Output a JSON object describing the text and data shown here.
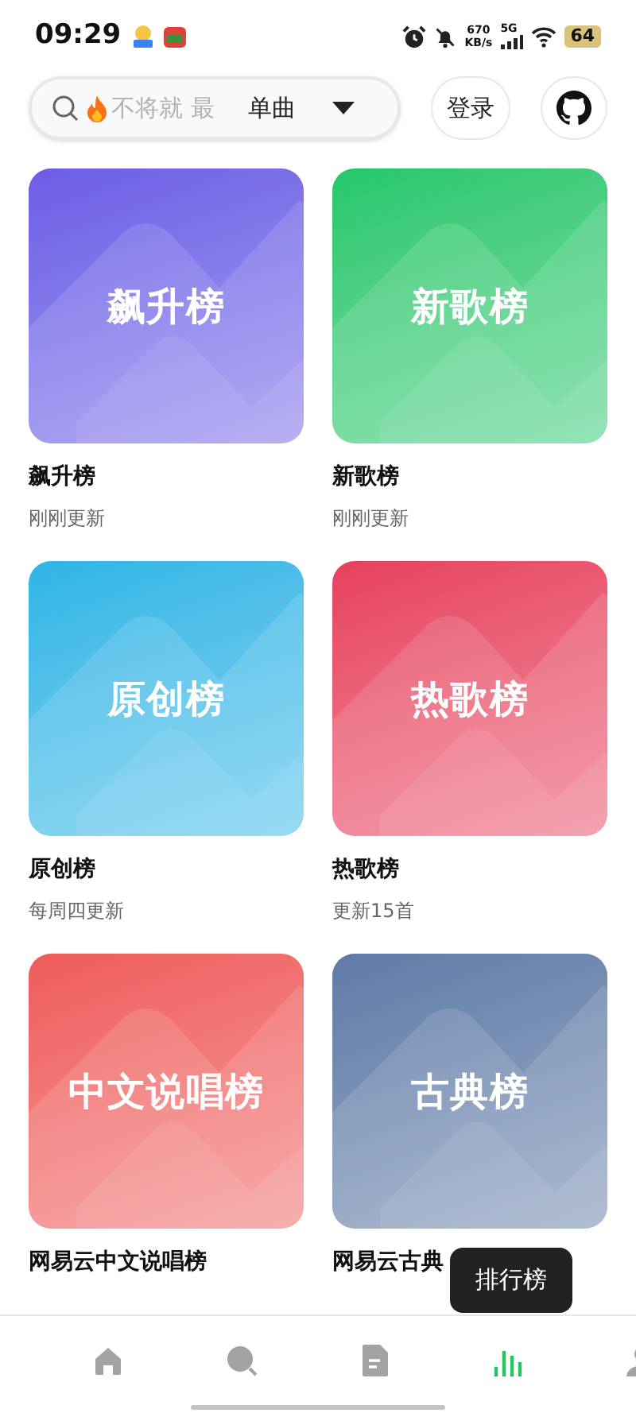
{
  "status_bar": {
    "time": "09:29",
    "net_speed": "670",
    "net_unit": "KB/s",
    "network": "5G",
    "battery": "64"
  },
  "search": {
    "placeholder": "不将就 最",
    "type_label": "单曲"
  },
  "login_button": "登录",
  "charts": [
    {
      "cover_label": "飙升榜",
      "title": "飙升榜",
      "subtitle": "刚刚更新",
      "color": "#6d5ce6"
    },
    {
      "cover_label": "新歌榜",
      "title": "新歌榜",
      "subtitle": "刚刚更新",
      "color": "#22c76b"
    },
    {
      "cover_label": "原创榜",
      "title": "原创榜",
      "subtitle": "每周四更新",
      "color": "#2cb5e6"
    },
    {
      "cover_label": "热歌榜",
      "title": "热歌榜",
      "subtitle": "更新15首",
      "color": "#e6405f"
    },
    {
      "cover_label": "中文说唱榜",
      "title": "网易云中文说唱榜",
      "color": "#ee5b5b"
    },
    {
      "cover_label": "古典榜",
      "title": "网易云古典",
      "color": "#5f7ba6"
    }
  ],
  "toast": "排行榜",
  "nav": [
    {
      "kind": "home",
      "selected": false
    },
    {
      "kind": "search",
      "selected": false
    },
    {
      "kind": "doc",
      "selected": false
    },
    {
      "kind": "chart",
      "selected": true
    },
    {
      "kind": "user",
      "selected": false
    }
  ]
}
